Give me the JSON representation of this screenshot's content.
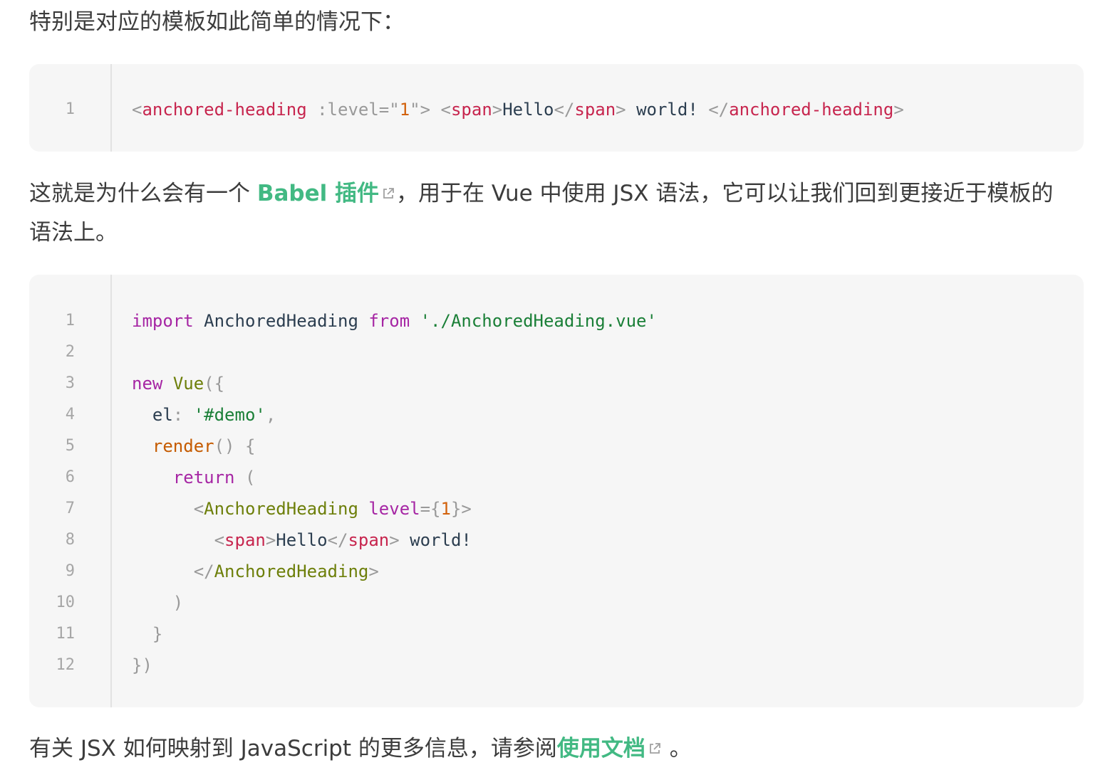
{
  "intro": "特别是对应的模板如此简单的情况下：",
  "block1": {
    "line_numbers": [
      "1"
    ],
    "lines": [
      [
        {
          "c": "t-punc",
          "t": "<"
        },
        {
          "c": "t-tag",
          "t": "anchored-heading"
        },
        {
          "c": "t-plain",
          "t": " "
        },
        {
          "c": "t-attr",
          "t": ":level"
        },
        {
          "c": "t-punc",
          "t": "=\""
        },
        {
          "c": "t-num",
          "t": "1"
        },
        {
          "c": "t-punc",
          "t": "\">"
        },
        {
          "c": "t-plain",
          "t": " "
        },
        {
          "c": "t-punc",
          "t": "<"
        },
        {
          "c": "t-tag",
          "t": "span"
        },
        {
          "c": "t-punc",
          "t": ">"
        },
        {
          "c": "t-plain",
          "t": "Hello"
        },
        {
          "c": "t-punc",
          "t": "</"
        },
        {
          "c": "t-tag",
          "t": "span"
        },
        {
          "c": "t-punc",
          "t": ">"
        },
        {
          "c": "t-plain",
          "t": " world! "
        },
        {
          "c": "t-punc",
          "t": "</"
        },
        {
          "c": "t-tag",
          "t": "anchored-heading"
        },
        {
          "c": "t-punc",
          "t": ">"
        }
      ]
    ]
  },
  "para2": {
    "before": "这就是为什么会有一个 ",
    "link": "Babel 插件",
    "after": "，用于在 Vue 中使用 JSX 语法，它可以让我们回到更接近于模板的",
    "line2": "语法上。"
  },
  "block2": {
    "line_numbers": [
      "1",
      "2",
      "3",
      "4",
      "5",
      "6",
      "7",
      "8",
      "9",
      "10",
      "11",
      "12"
    ],
    "lines": [
      [
        {
          "c": "t-kw",
          "t": "import"
        },
        {
          "c": "t-plain",
          "t": " AnchoredHeading "
        },
        {
          "c": "t-kw",
          "t": "from"
        },
        {
          "c": "t-plain",
          "t": " "
        },
        {
          "c": "t-str",
          "t": "'./AnchoredHeading.vue'"
        }
      ],
      [],
      [
        {
          "c": "t-kw",
          "t": "new"
        },
        {
          "c": "t-plain",
          "t": " "
        },
        {
          "c": "t-comp",
          "t": "Vue"
        },
        {
          "c": "t-punc",
          "t": "({"
        }
      ],
      [
        {
          "c": "t-plain",
          "t": "  el"
        },
        {
          "c": "t-punc",
          "t": ":"
        },
        {
          "c": "t-plain",
          "t": " "
        },
        {
          "c": "t-str",
          "t": "'#demo'"
        },
        {
          "c": "t-punc",
          "t": ","
        }
      ],
      [
        {
          "c": "t-plain",
          "t": "  "
        },
        {
          "c": "t-fn",
          "t": "render"
        },
        {
          "c": "t-punc",
          "t": "()"
        },
        {
          "c": "t-plain",
          "t": " "
        },
        {
          "c": "t-punc",
          "t": "{"
        }
      ],
      [
        {
          "c": "t-plain",
          "t": "    "
        },
        {
          "c": "t-kw",
          "t": "return"
        },
        {
          "c": "t-plain",
          "t": " "
        },
        {
          "c": "t-punc",
          "t": "("
        }
      ],
      [
        {
          "c": "t-plain",
          "t": "      "
        },
        {
          "c": "t-punc",
          "t": "<"
        },
        {
          "c": "t-comp",
          "t": "AnchoredHeading"
        },
        {
          "c": "t-plain",
          "t": " "
        },
        {
          "c": "t-kw",
          "t": "level"
        },
        {
          "c": "t-punc",
          "t": "={"
        },
        {
          "c": "t-num",
          "t": "1"
        },
        {
          "c": "t-punc",
          "t": "}>"
        }
      ],
      [
        {
          "c": "t-plain",
          "t": "        "
        },
        {
          "c": "t-punc",
          "t": "<"
        },
        {
          "c": "t-tag",
          "t": "span"
        },
        {
          "c": "t-punc",
          "t": ">"
        },
        {
          "c": "t-plain",
          "t": "Hello"
        },
        {
          "c": "t-punc",
          "t": "</"
        },
        {
          "c": "t-tag",
          "t": "span"
        },
        {
          "c": "t-punc",
          "t": ">"
        },
        {
          "c": "t-plain",
          "t": " world!"
        }
      ],
      [
        {
          "c": "t-plain",
          "t": "      "
        },
        {
          "c": "t-punc",
          "t": "</"
        },
        {
          "c": "t-comp",
          "t": "AnchoredHeading"
        },
        {
          "c": "t-punc",
          "t": ">"
        }
      ],
      [
        {
          "c": "t-plain",
          "t": "    "
        },
        {
          "c": "t-punc",
          "t": ")"
        }
      ],
      [
        {
          "c": "t-plain",
          "t": "  "
        },
        {
          "c": "t-punc",
          "t": "}"
        }
      ],
      [
        {
          "c": "t-punc",
          "t": "})"
        }
      ]
    ]
  },
  "para3": {
    "before": "有关 JSX 如何映射到 JavaScript 的更多信息，请参阅",
    "link": "使用文档",
    "after": " 。"
  },
  "colors": {
    "link": "#42b983",
    "code_bg": "#f6f6f6",
    "tag": "#c7254e",
    "keyword": "#a626a4",
    "string": "#1a7f37",
    "number": "#d2620d",
    "component": "#6d7f0a",
    "function": "#c55b00",
    "punctuation": "#999999"
  },
  "icons": {
    "external_link": "external-link-icon"
  }
}
